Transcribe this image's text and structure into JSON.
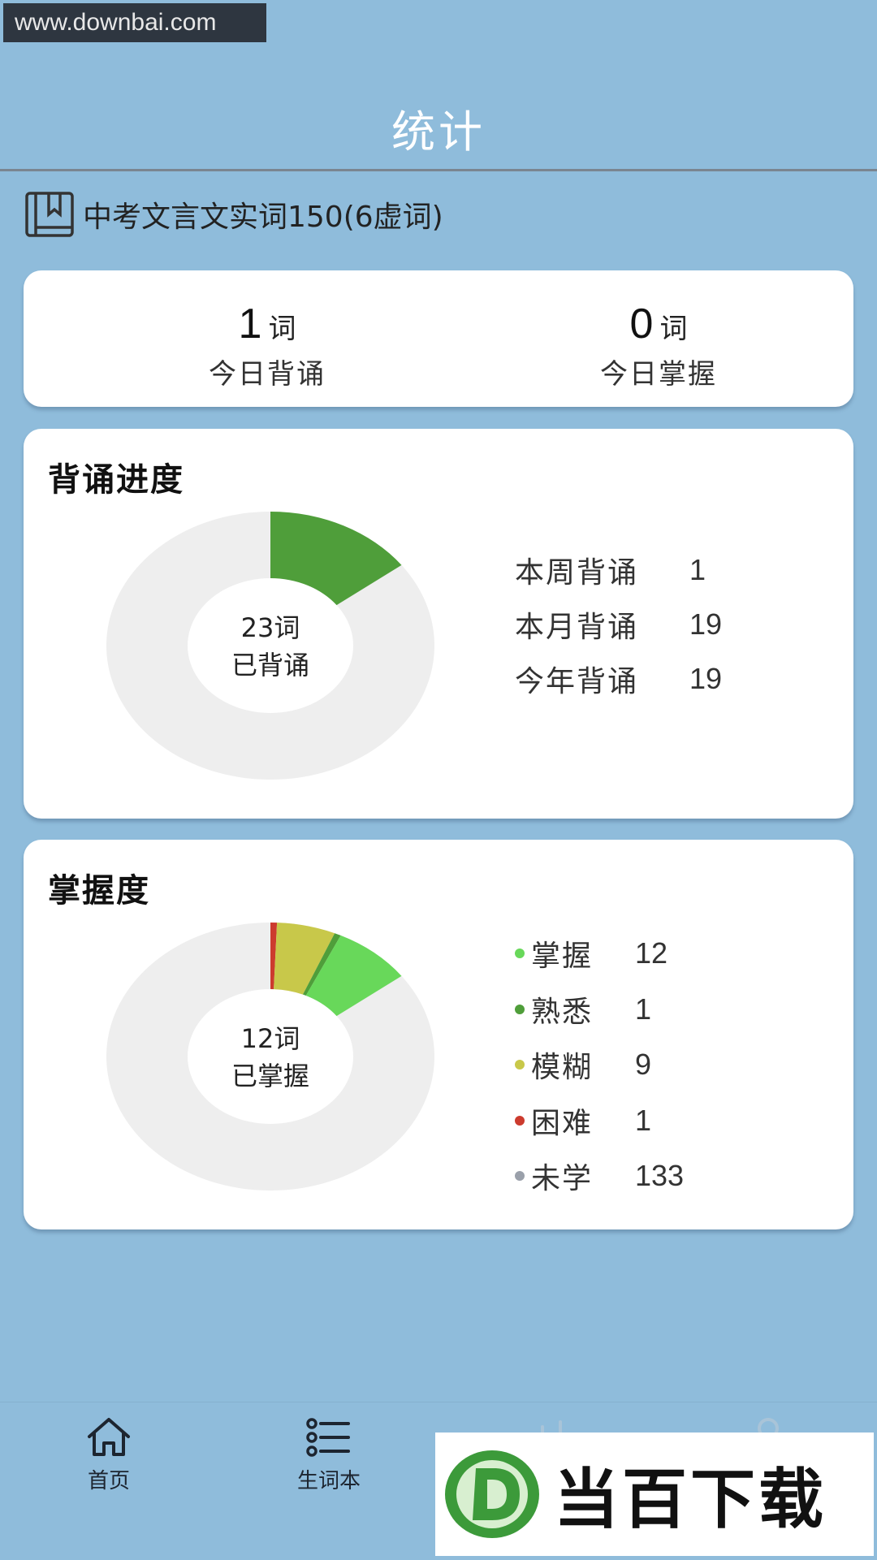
{
  "watermark_url": "www.downbai.com",
  "header": {
    "title": "统计"
  },
  "book": {
    "title": "中考文言文实词150(6虚词)"
  },
  "today": {
    "recite": {
      "value": "1",
      "unit": "词",
      "label": "今日背诵"
    },
    "master": {
      "value": "0",
      "unit": "词",
      "label": "今日掌握"
    }
  },
  "progress": {
    "title": "背诵进度",
    "center_line1": "23词",
    "center_line2": "已背诵",
    "stats": [
      {
        "label": "本周背诵",
        "value": "1"
      },
      {
        "label": "本月背诵",
        "value": "19"
      },
      {
        "label": "今年背诵",
        "value": "19"
      }
    ],
    "chart_data": {
      "type": "pie",
      "donut_done": 23,
      "donut_total": 156,
      "colors": {
        "done": "#4f9e3a",
        "rest": "#eeeeee"
      }
    }
  },
  "mastery": {
    "title": "掌握度",
    "center_line1": "12词",
    "center_line2": "已掌握",
    "chart_data": {
      "type": "pie",
      "series": [
        {
          "name": "掌握",
          "value": 12,
          "color": "#68d85a"
        },
        {
          "name": "熟悉",
          "value": 1,
          "color": "#4f9e3a"
        },
        {
          "name": "模糊",
          "value": 9,
          "color": "#c8c84a"
        },
        {
          "name": "困难",
          "value": 1,
          "color": "#cc3b2e"
        },
        {
          "name": "未学",
          "value": 133,
          "color": "#9aa0aa"
        }
      ],
      "rest_color": "#eeeeee"
    },
    "legend": [
      {
        "label": "掌握",
        "value": "12",
        "color": "#68d85a"
      },
      {
        "label": "熟悉",
        "value": "1",
        "color": "#4f9e3a"
      },
      {
        "label": "模糊",
        "value": "9",
        "color": "#c8c84a"
      },
      {
        "label": "困难",
        "value": "1",
        "color": "#cc3b2e"
      },
      {
        "label": "未学",
        "value": "133",
        "color": "#9aa0aa"
      }
    ]
  },
  "tabs": [
    {
      "label": "首页",
      "icon": "home-icon"
    },
    {
      "label": "生词本",
      "icon": "list-icon"
    },
    {
      "label": "",
      "icon": "bar-chart-icon"
    },
    {
      "label": "",
      "icon": "user-icon"
    }
  ],
  "watermark_logo": {
    "text": "当百下载"
  }
}
